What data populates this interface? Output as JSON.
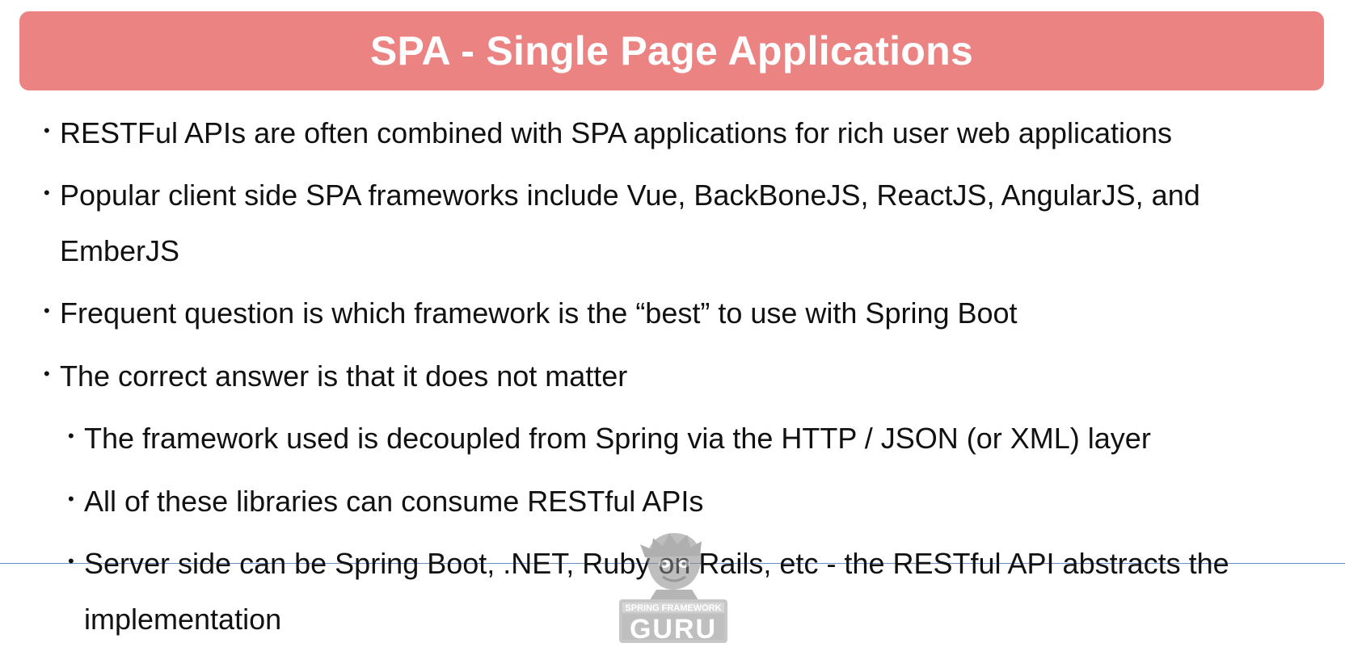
{
  "slide": {
    "title": "SPA - Single Page Applications",
    "title_bar_color": "#ec8383",
    "bullets": [
      {
        "text": "RESTFul APIs are often combined with SPA applications for rich user web applications"
      },
      {
        "line1": "Popular client side SPA frameworks include Vue, BackBoneJS, ReactJS, AngularJS, and",
        "line2": "EmberJS"
      },
      {
        "text": "Frequent question is which framework is the “best” to use with Spring Boot"
      },
      {
        "text": "The correct answer is that it does not matter"
      }
    ],
    "sub_bullets": [
      {
        "text": "The framework used is decoupled from Spring via the HTTP / JSON (or XML) layer"
      },
      {
        "text": "All of these libraries can consume RESTful APIs"
      },
      {
        "line1": "Server side can be Spring Boot, .NET, Ruby on Rails, etc - the RESTful API abstracts the",
        "line2": "implementation"
      }
    ],
    "bullet_glyph": "•"
  },
  "logo": {
    "top_text": "SPRING FRAMEWORK",
    "bottom_text": "GURU"
  }
}
